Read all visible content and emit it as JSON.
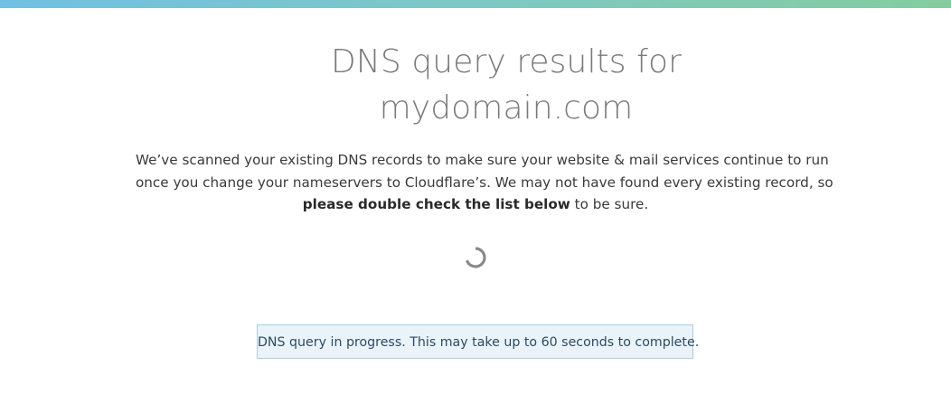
{
  "header": {
    "title_line1": "DNS query results for",
    "title_line2": "mydomain.com"
  },
  "description": {
    "line1": "We’ve scanned your existing DNS records to make sure your website & mail services continue to run",
    "line2": "once you change your nameservers to Cloudflare’s. We may not have found every existing record, so",
    "line3_bold": "please double check the list below",
    "line3_rest": " to be sure."
  },
  "status": {
    "message": "DNS query in progress. This may take up to 60 seconds to complete."
  },
  "colors": {
    "gradient_start": "#6fc0e2",
    "gradient_end": "#84cc9f",
    "notice_background": "#eaf3fa",
    "notice_border": "#a9cde6",
    "spinner": "#8a8a8a"
  },
  "icons": {
    "spinner": "loading-spinner-icon"
  }
}
